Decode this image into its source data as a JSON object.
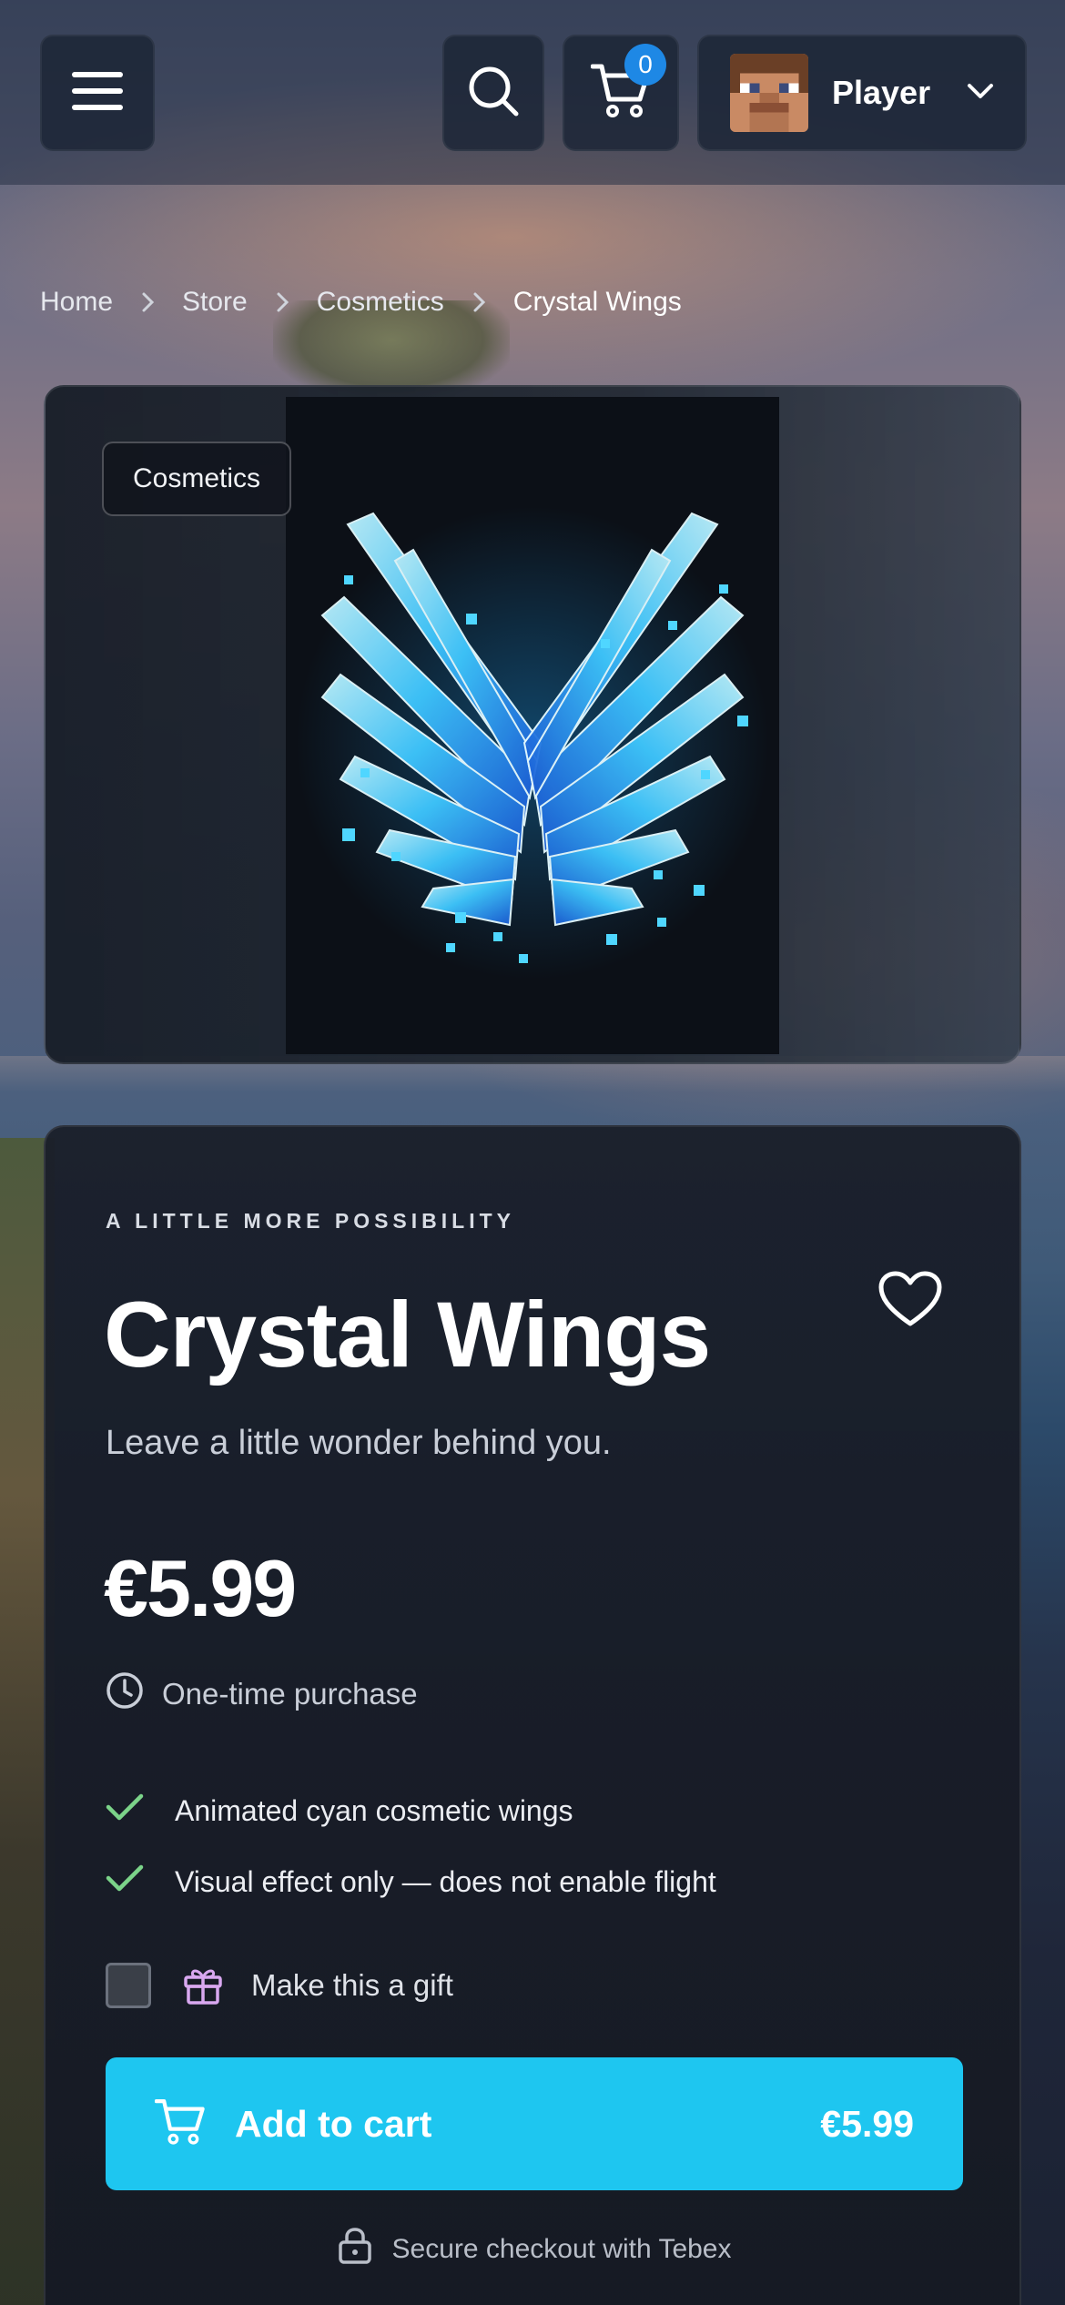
{
  "header": {
    "menu_icon": "hamburger-menu-icon",
    "search_icon": "search-icon",
    "cart_icon": "cart-icon",
    "cart_count": "0",
    "user": {
      "name": "Player",
      "avatar_icon": "player-skin-avatar",
      "chevron_icon": "chevron-down-icon"
    }
  },
  "breadcrumb": {
    "items": [
      "Home",
      "Store",
      "Cosmetics",
      "Crystal Wings"
    ],
    "separator_icon": "chevron-right-icon"
  },
  "product_image": {
    "category_badge": "Cosmetics",
    "art_icon": "crystal-wings-art"
  },
  "product": {
    "eyebrow": "A LITTLE MORE POSSIBILITY",
    "title": "Crystal Wings",
    "favorite_icon": "heart-icon",
    "subtitle": "Leave a little wonder behind you.",
    "price": "€5.99",
    "purchase_type": "One-time purchase",
    "purchase_type_icon": "clock-icon",
    "features": [
      "Animated cyan cosmetic wings",
      "Visual effect only — does not enable flight"
    ],
    "feature_icon": "check-icon",
    "gift": {
      "label": "Make this a gift",
      "checked": false,
      "icon": "gift-icon"
    },
    "add_to_cart": {
      "label": "Add to cart",
      "price": "€5.99",
      "icon": "cart-icon"
    },
    "secure_checkout": {
      "text": "Secure checkout with Tebex",
      "icon": "lock-icon"
    }
  },
  "colors": {
    "accent": "#1ec6f0",
    "badge_blue": "#1e88e5",
    "check_green": "#7bd389",
    "gift_purple": "#d9a8f0",
    "card_bg": "#1a1f2a"
  }
}
